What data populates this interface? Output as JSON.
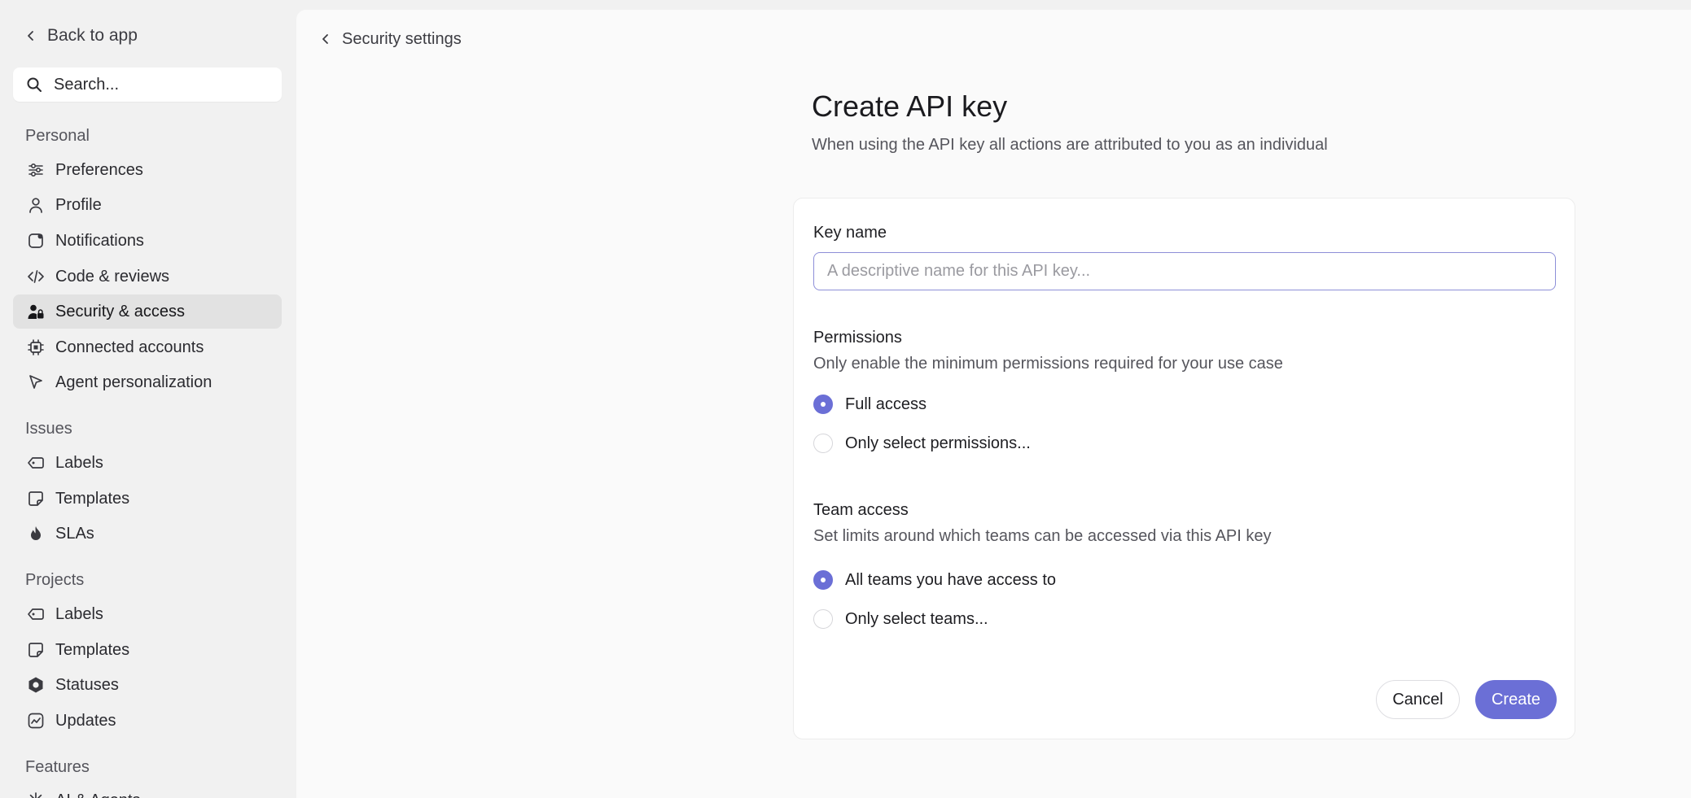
{
  "sidebar": {
    "back_label": "Back to app",
    "search_placeholder": "Search...",
    "sections": {
      "personal": "Personal",
      "issues": "Issues",
      "projects": "Projects",
      "features": "Features"
    },
    "personal_items": [
      {
        "label": "Preferences",
        "icon": "sliders-icon"
      },
      {
        "label": "Profile",
        "icon": "person-icon"
      },
      {
        "label": "Notifications",
        "icon": "notification-icon"
      },
      {
        "label": "Code & reviews",
        "icon": "code-icon"
      },
      {
        "label": "Security & access",
        "icon": "user-lock-icon",
        "active": true
      },
      {
        "label": "Connected accounts",
        "icon": "chip-icon"
      },
      {
        "label": "Agent personalization",
        "icon": "cursor-icon"
      }
    ],
    "issues_items": [
      {
        "label": "Labels",
        "icon": "label-icon"
      },
      {
        "label": "Templates",
        "icon": "template-icon"
      },
      {
        "label": "SLAs",
        "icon": "flame-icon"
      }
    ],
    "projects_items": [
      {
        "label": "Labels",
        "icon": "label-icon"
      },
      {
        "label": "Templates",
        "icon": "template-icon"
      },
      {
        "label": "Statuses",
        "icon": "hexagon-icon"
      },
      {
        "label": "Updates",
        "icon": "chart-icon"
      }
    ],
    "features_items": [
      {
        "label": "AI & Agents",
        "icon": "sparkle-icon"
      }
    ]
  },
  "main": {
    "breadcrumb": "Security settings",
    "title": "Create API key",
    "subtitle": "When using the API key all actions are attributed to you as an individual",
    "form": {
      "key_name_label": "Key name",
      "key_name_placeholder": "A descriptive name for this API key...",
      "key_name_value": "",
      "permissions_label": "Permissions",
      "permissions_desc": "Only enable the minimum permissions required for your use case",
      "permissions_options": [
        {
          "label": "Full access",
          "checked": true
        },
        {
          "label": "Only select permissions...",
          "checked": false
        }
      ],
      "team_label": "Team access",
      "team_desc": "Set limits around which teams can be accessed via this API key",
      "team_options": [
        {
          "label": "All teams you have access to",
          "checked": true
        },
        {
          "label": "Only select teams...",
          "checked": false
        }
      ],
      "cancel_label": "Cancel",
      "create_label": "Create"
    }
  },
  "colors": {
    "accent": "#6b6fd6",
    "sidebar_bg": "#f1f1f1",
    "active_item_bg": "#e2e2e2",
    "panel_bg": "#fafafa"
  }
}
